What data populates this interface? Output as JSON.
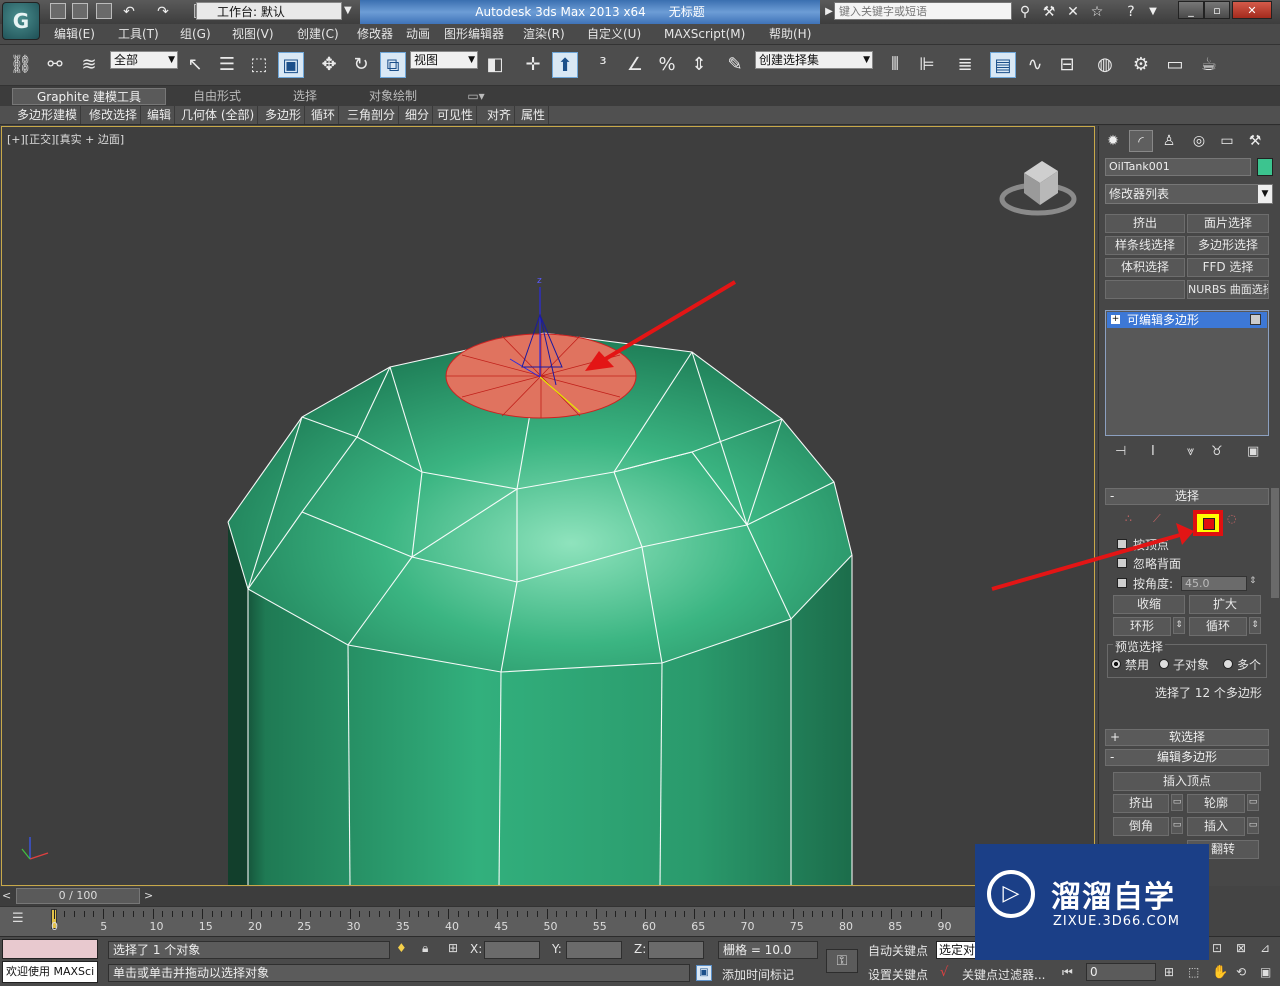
{
  "titlebar": {
    "workspace": "工作台: 默认",
    "app_title": "Autodesk 3ds Max  2013 x64",
    "doc_title": "无标题",
    "search_placeholder": "键入关键字或短语",
    "minimize": "_",
    "restore": "▫",
    "close": "✕"
  },
  "menu": [
    "编辑(E)",
    "工具(T)",
    "组(G)",
    "视图(V)",
    "创建(C)",
    "修改器",
    "动画",
    "图形编辑器",
    "渲染(R)",
    "自定义(U)",
    "MAXScript(M)",
    "帮助(H)"
  ],
  "toolbar": {
    "selection_filter": "全部",
    "ref_coord": "视图",
    "named_selection": "创建选择集"
  },
  "ribbon": {
    "tabs": [
      "Graphite 建模工具",
      "自由形式",
      "选择",
      "对象绘制"
    ],
    "panel_items": [
      "多边形建模",
      "修改选择",
      "编辑",
      "几何体 (全部)",
      "多边形",
      "循环",
      "三角剖分",
      "细分",
      "可见性",
      "对齐",
      "属性"
    ]
  },
  "viewport": {
    "label": "[+][正交][真实 + 边面]",
    "gizmo_axis": "z"
  },
  "cmdpanel": {
    "object_name": "OilTank001",
    "object_color": "#3cc48f",
    "modifier_list": "修改器列表",
    "mod_buttons": [
      "挤出",
      "面片选择",
      "样条线选择",
      "多边形选择",
      "体积选择",
      "FFD 选择",
      "",
      "NURBS 曲面选择"
    ],
    "stack_item": "可编辑多边形",
    "selection": {
      "title": "选择",
      "by_vertex": "按顶点",
      "ignore_backface": "忽略背面",
      "by_angle": "按角度:",
      "angle_value": "45.0",
      "shrink": "收缩",
      "grow": "扩大",
      "ring": "环形",
      "loop": "循环",
      "preview_title": "预览选择",
      "preview_off": "禁用",
      "preview_sub": "子对象",
      "preview_multi": "多个",
      "status": "选择了 12 个多边形"
    },
    "soft_selection": "软选择",
    "edit_poly": {
      "title": "编辑多边形",
      "insert_vertex": "插入顶点",
      "extrude": "挤出",
      "outline": "轮廓",
      "bevel": "倒角",
      "inset": "插入",
      "flip": "翻转"
    }
  },
  "timeline": {
    "frame": "0 / 100",
    "ticks": [
      "0",
      "5",
      "10",
      "15",
      "20",
      "25",
      "30",
      "35",
      "40",
      "45",
      "50",
      "55",
      "60",
      "65",
      "70",
      "75",
      "80",
      "85",
      "90"
    ]
  },
  "status": {
    "listener": "欢迎使用 MAXSci",
    "selected": "选择了 1 个对象",
    "prompt": "单击或单击并拖动以选择对象",
    "x_label": "X:",
    "y_label": "Y:",
    "z_label": "Z:",
    "grid": "栅格 = 10.0",
    "add_time_tag": "添加时间标记",
    "auto_key": "自动关键点",
    "set_key": "设置关键点",
    "selected_set": "选定对",
    "key_filters": "关键点过滤器...",
    "frame_field": "0"
  },
  "watermark": {
    "title": "溜溜自学",
    "url": "ZIXUE.3D66.COM"
  },
  "colors": {
    "mesh": "#2fb07a",
    "selected_face": "#e0735f",
    "highlight": "#e01010",
    "viewport_border": "#c8a94a"
  }
}
